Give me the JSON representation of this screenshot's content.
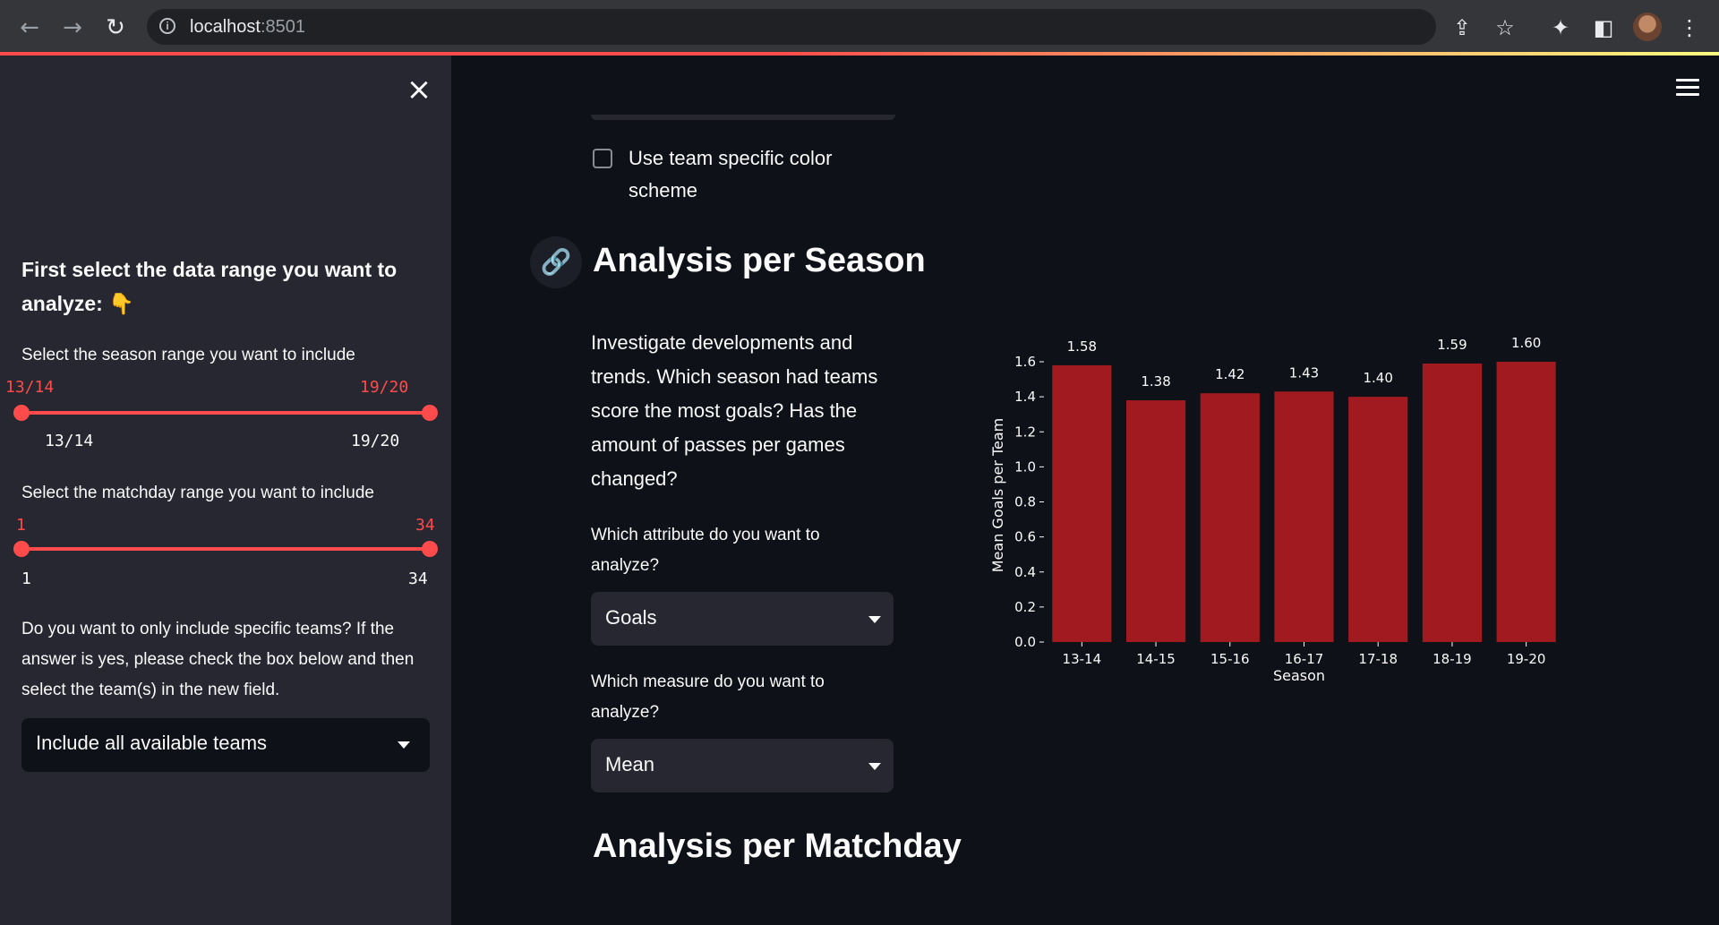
{
  "browser": {
    "url_host": "localhost",
    "url_port": ":8501"
  },
  "sidebar": {
    "heading": "First select the data range you want to analyze: 👇",
    "season_range": {
      "label": "Select the season range you want to include",
      "value_min": "13/14",
      "value_max": "19/20",
      "tick_min": "13/14",
      "tick_max": "19/20"
    },
    "matchday_range": {
      "label": "Select the matchday range you want to include",
      "value_min": "1",
      "value_max": "34",
      "tick_min": "1",
      "tick_max": "34"
    },
    "teams_prompt": "Do you want to only include specific teams? If the answer is yes, please check the box below and then select the team(s) in the new field.",
    "teams_select": "Include all available teams"
  },
  "main": {
    "checkbox_label": "Use team specific color scheme",
    "checkbox_checked": false,
    "season_heading": "Analysis per Season",
    "intro": "Investigate developments and trends. Which season had teams score the most goals? Has the amount of passes per games changed?",
    "attribute_question": "Which attribute do you want to analyze?",
    "attribute_value": "Goals",
    "measure_question": "Which measure do you want to analyze?",
    "measure_value": "Mean",
    "matchday_heading": "Analysis per Matchday"
  },
  "colors": {
    "accent": "#ff4b4b",
    "bar": "#a11a1f",
    "background": "#0e1117",
    "sidebar": "#262730"
  },
  "chart_data": {
    "type": "bar",
    "categories": [
      "13-14",
      "14-15",
      "15-16",
      "16-17",
      "17-18",
      "18-19",
      "19-20"
    ],
    "values": [
      1.58,
      1.38,
      1.42,
      1.43,
      1.4,
      1.59,
      1.6
    ],
    "value_labels": [
      "1.58",
      "1.38",
      "1.42",
      "1.43",
      "1.40",
      "1.59",
      "1.60"
    ],
    "xlabel": "Season",
    "ylabel": "Mean Goals  per Team",
    "yticks": [
      "0.0",
      "0.2",
      "0.4",
      "0.6",
      "0.8",
      "1.0",
      "1.2",
      "1.4",
      "1.6"
    ],
    "ylim": [
      0,
      1.6
    ],
    "grid": false
  }
}
